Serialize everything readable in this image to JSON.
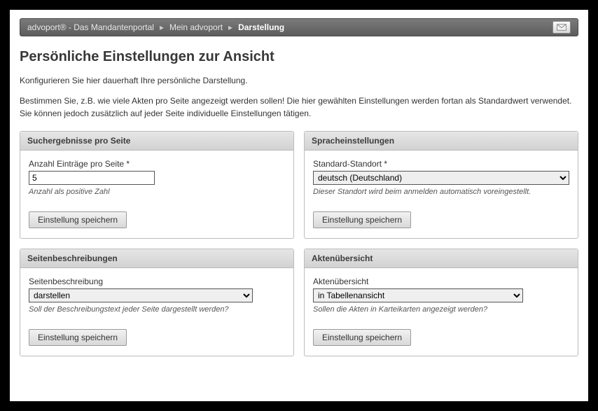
{
  "breadcrumb": {
    "items": [
      "advoport® - Das Mandantenportal",
      "Mein advoport",
      "Darstellung"
    ]
  },
  "page_title": "Persönliche Einstellungen zur Ansicht",
  "intro1": "Konfigurieren Sie hier dauerhaft Ihre persönliche Darstellung.",
  "intro2": "Bestimmen Sie, z.B. wie viele Akten pro Seite angezeigt werden sollen! Die hier gewählten Einstellungen werden fortan als Standardwert verwendet. Sie können jedoch zusätzlich auf jeder Seite individuelle Einstellungen tätigen.",
  "buttons": {
    "save": "Einstellung speichern"
  },
  "panels": {
    "results": {
      "title": "Suchergebnisse pro Seite",
      "label": "Anzahl Einträge pro Seite *",
      "value": "5",
      "hint": "Anzahl als positive Zahl"
    },
    "language": {
      "title": "Spracheinstellungen",
      "label": "Standard-Standort *",
      "value": "deutsch (Deutschland)",
      "hint": "Dieser Standort wird beim anmelden automatisch voreingestellt."
    },
    "descriptions": {
      "title": "Seitenbeschreibungen",
      "label": "Seitenbeschreibung",
      "value": "darstellen",
      "hint": "Soll der Beschreibungstext jeder Seite dargestellt werden?"
    },
    "files": {
      "title": "Aktenübersicht",
      "label": "Aktenübersicht",
      "value": "in Tabellenansicht",
      "hint": "Sollen die Akten in Karteikarten angezeigt werden?"
    }
  }
}
